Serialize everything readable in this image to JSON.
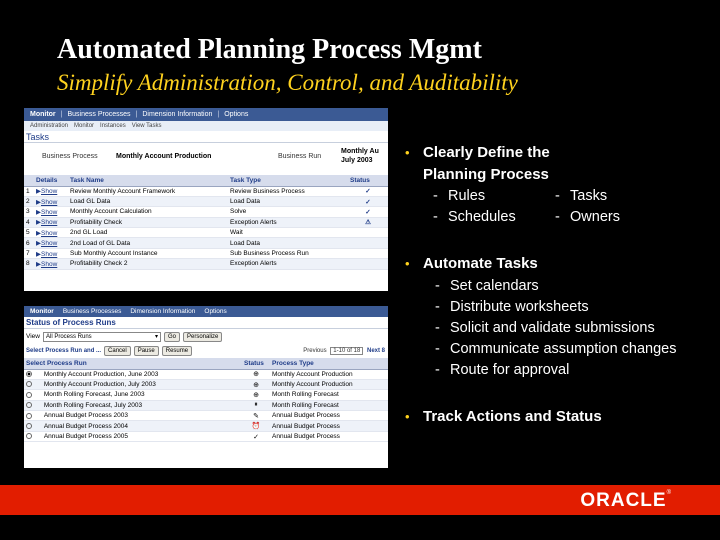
{
  "title": "Automated Planning Process Mgmt",
  "subtitle": "Simplify Administration, Control, and Auditability",
  "shot1": {
    "nav": [
      "Monitor",
      "|",
      "Business Processes",
      "|",
      "Dimension Information",
      "|",
      "Options"
    ],
    "subnav": [
      "Administration",
      "Monitor",
      "Instances",
      "View Tasks"
    ],
    "heading": "Tasks",
    "business_process_label": "Business Process",
    "business_process_value": "Monthly Account Production",
    "business_run_label": "Business Run",
    "business_run_value_line1": "Monthly Au",
    "business_run_value_line2": "July 2003",
    "columns": [
      "Details",
      "Task Name",
      "Task Type",
      "Status"
    ],
    "rows": [
      {
        "num": "1",
        "details": "Show",
        "task": "Review Monthly Account Framework",
        "type": "Review Business Process",
        "status": "✓"
      },
      {
        "num": "2",
        "details": "Show",
        "task": "Load GL Data",
        "type": "Load Data",
        "status": "✓"
      },
      {
        "num": "3",
        "details": "Show",
        "task": "Monthly Account Calculation",
        "type": "Solve",
        "status": "✓"
      },
      {
        "num": "4",
        "details": "Show",
        "task": "Profitability Check",
        "type": "Exception Alerts",
        "status": "⚠"
      },
      {
        "num": "5",
        "details": "Show",
        "task": "2nd GL Load",
        "type": "Wait",
        "status": ""
      },
      {
        "num": "6",
        "details": "Show",
        "task": "2nd Load of GL Data",
        "type": "Load Data",
        "status": ""
      },
      {
        "num": "7",
        "details": "Show",
        "task": "Sub Monthly Account Instance",
        "type": "Sub Business Process Run",
        "status": ""
      },
      {
        "num": "8",
        "details": "Show",
        "task": "Profitability Check 2",
        "type": "Exception Alerts",
        "status": ""
      }
    ]
  },
  "shot2": {
    "nav": [
      "Monitor",
      "Business Processes",
      "Dimension Information",
      "Options"
    ],
    "heading": "Status of Process Runs",
    "view_label": "View",
    "view_value": "All Process Runs",
    "go_label": "Go",
    "personalize_label": "Personalize",
    "actions": [
      "Select Process Run and ...",
      "Cancel",
      "Pause",
      "Resume"
    ],
    "pager_prev": "Previous",
    "pager_range": "1-10 of 18",
    "pager_next": "Next 8",
    "columns": [
      "Select Process Run",
      "Status",
      "Process Type"
    ],
    "rows": [
      {
        "run": "Monthly Account Production, June 2003",
        "status": "⊕",
        "type": "Monthly Account Production"
      },
      {
        "run": "Monthly Account Production, July 2003",
        "status": "⊕",
        "type": "Monthly Account Production"
      },
      {
        "run": "Month Rolling Forecast, June 2003",
        "status": "⊕",
        "type": "Month Rolling Forecast"
      },
      {
        "run": "Month Rolling Forecast, July 2003",
        "status": "⏸",
        "type": "Month Rolling Forecast"
      },
      {
        "run": "Annual Budget Process 2003",
        "status": "✎",
        "type": "Annual Budget Process"
      },
      {
        "run": "Annual Budget Process 2004",
        "status": "⏰",
        "type": "Annual Budget Process"
      },
      {
        "run": "Annual Budget Process 2005",
        "status": "✓",
        "type": "Annual Budget Process"
      }
    ]
  },
  "bullets": {
    "b1": "Clearly Define the",
    "b1_line2": "Planning Process",
    "b1_subs": [
      "Rules",
      "Tasks",
      "Schedules",
      "Owners"
    ],
    "b2": "Automate Tasks",
    "b2_subs": [
      "Set calendars",
      "Distribute worksheets",
      "Solicit and validate submissions",
      "Communicate assumption changes",
      "Route for approval"
    ],
    "b3": "Track Actions and Status",
    "dash": "-"
  },
  "footer": {
    "logo": "ORACLE",
    "trademark": "®"
  },
  "colors": {
    "background": "#000000",
    "title": "#ffffff",
    "subtitle": "#ffd21e",
    "footer": "#e21d00",
    "nav": "#3b5a94"
  }
}
